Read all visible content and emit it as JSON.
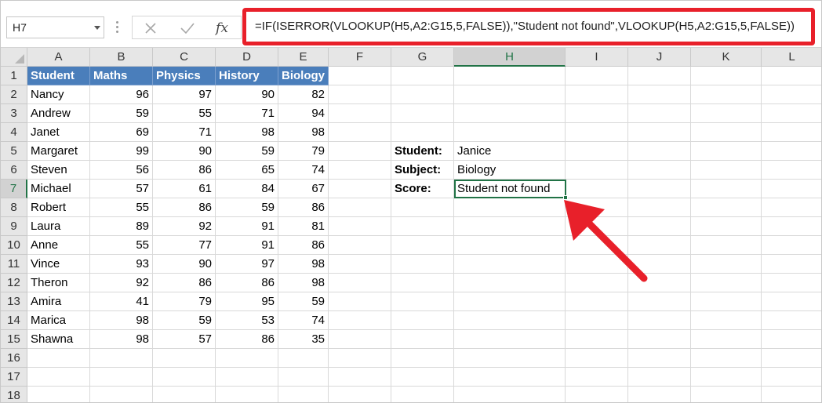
{
  "formula_bar": {
    "name_box": "H7",
    "cancel_icon": "✕",
    "enter_icon": "✓",
    "fx_label": "fx",
    "formula": "=IF(ISERROR(VLOOKUP(H5,A2:G15,5,FALSE)),\"Student not found\",VLOOKUP(H5,A2:G15,5,FALSE))"
  },
  "columns": [
    "A",
    "B",
    "C",
    "D",
    "E",
    "F",
    "G",
    "H",
    "I",
    "J",
    "K",
    "L"
  ],
  "active_column": "H",
  "rows": [
    "1",
    "2",
    "3",
    "4",
    "5",
    "6",
    "7",
    "8",
    "9",
    "10",
    "11",
    "12",
    "13",
    "14",
    "15",
    "16",
    "17",
    "18"
  ],
  "active_row": "7",
  "table": {
    "headers": [
      "Student",
      "Maths",
      "Physics",
      "History",
      "Biology"
    ],
    "rows": [
      [
        "Nancy",
        "96",
        "97",
        "90",
        "82"
      ],
      [
        "Andrew",
        "59",
        "55",
        "71",
        "94"
      ],
      [
        "Janet",
        "69",
        "71",
        "98",
        "98"
      ],
      [
        "Margaret",
        "99",
        "90",
        "59",
        "79"
      ],
      [
        "Steven",
        "56",
        "86",
        "65",
        "74"
      ],
      [
        "Michael",
        "57",
        "61",
        "84",
        "67"
      ],
      [
        "Robert",
        "55",
        "86",
        "59",
        "86"
      ],
      [
        "Laura",
        "89",
        "92",
        "91",
        "81"
      ],
      [
        "Anne",
        "55",
        "77",
        "91",
        "86"
      ],
      [
        "Vince",
        "93",
        "90",
        "97",
        "98"
      ],
      [
        "Theron",
        "92",
        "86",
        "86",
        "98"
      ],
      [
        "Amira",
        "41",
        "79",
        "95",
        "59"
      ],
      [
        "Marica",
        "98",
        "59",
        "53",
        "74"
      ],
      [
        "Shawna",
        "98",
        "57",
        "86",
        "35"
      ]
    ]
  },
  "lookup": {
    "student_label": "Student:",
    "student_value": "Janice",
    "subject_label": "Subject:",
    "subject_value": "Biology",
    "score_label": "Score:",
    "score_value": "Student not found"
  },
  "colors": {
    "header_fill": "#4a7ebb",
    "selection": "#217346",
    "highlight": "#e8202a"
  },
  "icons": {
    "cancel": "close-icon",
    "enter": "check-icon",
    "function": "fx-icon",
    "name_box_dropdown": "chevron-down-icon",
    "annotation": "red-arrow-icon"
  }
}
